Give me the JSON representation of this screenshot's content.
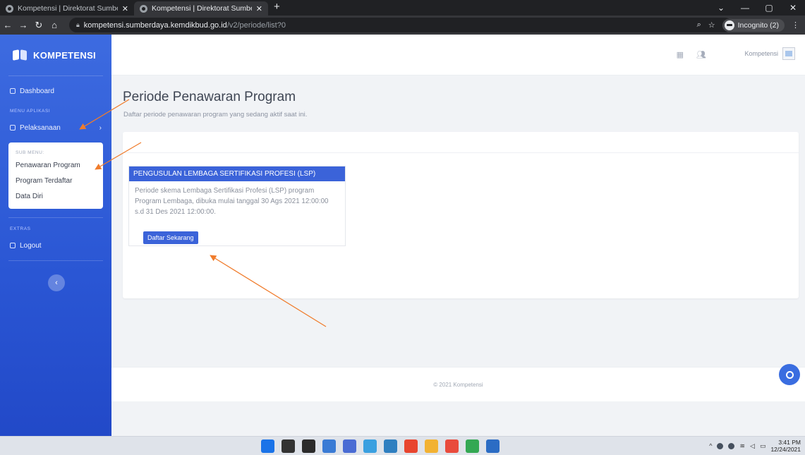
{
  "browser": {
    "tabs": [
      {
        "title": "Kompetensi | Direktorat Sumber"
      },
      {
        "title": "Kompetensi | Direktorat Sumber"
      }
    ],
    "url_host": "kompetensi.sumberdaya.kemdikbud.go.id",
    "url_path": "/v2/periode/list?0",
    "incognito_label": "Incognito (2)"
  },
  "sidebar": {
    "brand": "KOMPETENSI",
    "dashboard": "Dashboard",
    "menu_heading": "MENU APLIKASI",
    "pelaksanaan": "Pelaksanaan",
    "submenu_heading": "SUB MENU:",
    "submenu_items": [
      "Penawaran Program",
      "Program Terdaftar",
      "Data Diri"
    ],
    "extras_heading": "EXTRAS",
    "logout": "Logout"
  },
  "topbar": {
    "user_name": "Kompetensi"
  },
  "main": {
    "title": "Periode Penawaran Program",
    "subtitle": "Daftar periode penawaran program yang sedang aktif saat ini.",
    "program": {
      "heading": "PENGUSULAN LEMBAGA SERTIFIKASI PROFESI (LSP)",
      "description": "Periode skema Lembaga Sertifikasi Profesi (LSP) program Program Lembaga, dibuka mulai tanggal 30 Ags 2021 12:00:00 s.d 31 Des 2021 12:00:00.",
      "button": "Daftar Sekarang"
    }
  },
  "footer": {
    "text": "© 2021 Kompetensi"
  },
  "taskbar": {
    "time": "3:41 PM",
    "date": "12/24/2021",
    "app_colors": [
      "#1a73e8",
      "#333333",
      "#2b2b2b",
      "#3a7bd5",
      "#4a6cd4",
      "#3aa0e0",
      "#2f7fc0",
      "#e8452f",
      "#f2b233",
      "#e94b3c",
      "#34a853",
      "#2b6cc4"
    ]
  },
  "colors": {
    "sidebar": "#2a56d4",
    "accent": "#3b63d9",
    "annotation": "#f07c2c"
  }
}
